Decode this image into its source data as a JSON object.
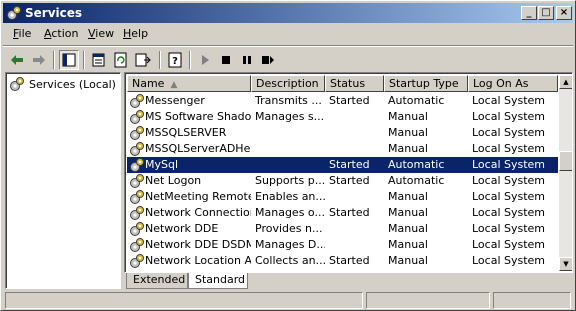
{
  "window": {
    "title": "Services",
    "icon": "services-gear-icon",
    "controls": [
      "_",
      "□",
      "×"
    ]
  },
  "menu": [
    {
      "label": "File",
      "mnemonic": "F",
      "rest": "ile"
    },
    {
      "label": "Action",
      "mnemonic": "A",
      "rest": "ction"
    },
    {
      "label": "View",
      "mnemonic": "V",
      "rest": "iew"
    },
    {
      "label": "Help",
      "mnemonic": "H",
      "rest": "elp"
    }
  ],
  "toolbar": {
    "buttons": [
      "back-icon",
      "forward-icon",
      "show-hide-tree-icon",
      "properties-icon",
      "refresh-icon",
      "export-list-icon",
      "help-icon",
      "start-service-icon",
      "stop-service-icon",
      "pause-service-icon",
      "restart-service-icon"
    ],
    "accent": "#0a246a"
  },
  "tree": {
    "root_label": "Services (Local)"
  },
  "list": {
    "columns": [
      "Name",
      "Description",
      "Status",
      "Startup Type",
      "Log On As"
    ],
    "sorted_column": "Name",
    "selected_index": 4,
    "rows": [
      {
        "name": "Messenger",
        "description": "Transmits ...",
        "status": "Started",
        "startup": "Automatic",
        "logon": "Local System"
      },
      {
        "name": "MS Software Shado...",
        "description": "Manages s...",
        "status": "",
        "startup": "Manual",
        "logon": "Local System"
      },
      {
        "name": "MSSQLSERVER",
        "description": "",
        "status": "",
        "startup": "Manual",
        "logon": "Local System"
      },
      {
        "name": "MSSQLServerADHel...",
        "description": "",
        "status": "",
        "startup": "Manual",
        "logon": "Local System"
      },
      {
        "name": "MySql",
        "description": "",
        "status": "Started",
        "startup": "Automatic",
        "logon": "Local System"
      },
      {
        "name": "Net Logon",
        "description": "Supports p...",
        "status": "Started",
        "startup": "Automatic",
        "logon": "Local System"
      },
      {
        "name": "NetMeeting Remote...",
        "description": "Enables an...",
        "status": "",
        "startup": "Manual",
        "logon": "Local System"
      },
      {
        "name": "Network Connections",
        "description": "Manages o...",
        "status": "Started",
        "startup": "Manual",
        "logon": "Local System"
      },
      {
        "name": "Network DDE",
        "description": "Provides n...",
        "status": "",
        "startup": "Manual",
        "logon": "Local System"
      },
      {
        "name": "Network DDE DSDM",
        "description": "Manages D...",
        "status": "",
        "startup": "Manual",
        "logon": "Local System"
      },
      {
        "name": "Network Location A...",
        "description": "Collects an...",
        "status": "Started",
        "startup": "Manual",
        "logon": "Local System"
      }
    ],
    "scroll_position": 0.42
  },
  "tabs": [
    {
      "label": "Extended"
    },
    {
      "label": "Standard"
    }
  ],
  "active_tab": "Standard",
  "selection_color": "#0a246a"
}
